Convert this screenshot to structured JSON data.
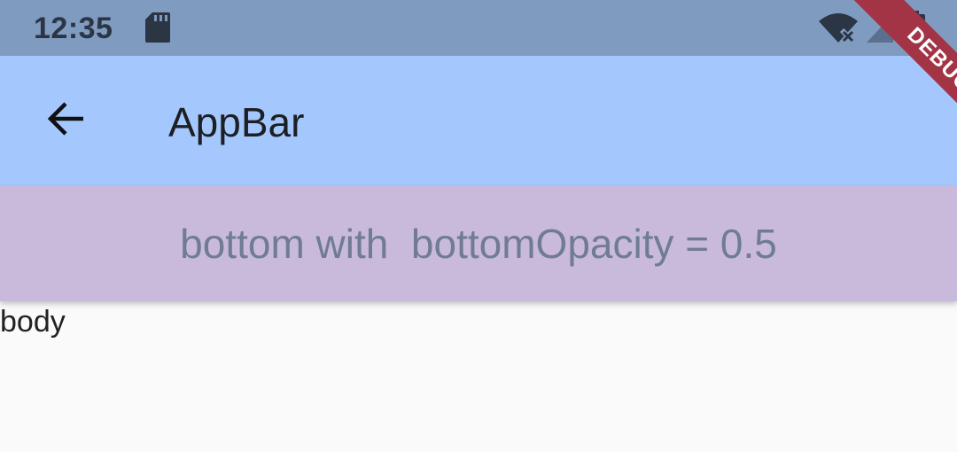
{
  "status_bar": {
    "time": "12:35",
    "icons": [
      "sd-card-icon",
      "wifi-off-icon",
      "signal-icon",
      "battery-charging-icon"
    ]
  },
  "app_bar": {
    "back_icon": "arrow-back-icon",
    "title": "AppBar",
    "bottom_text": "bottom with  bottomOpacity = 0.5"
  },
  "body": {
    "text": "body"
  },
  "debug_banner": {
    "label": "DEBUG"
  },
  "colors": {
    "status_bar": "#7f9bc0",
    "app_bar": "#a4c8fe",
    "bottom": "#c9badb",
    "bottom_text": "#6f7c92",
    "background": "#fafafa",
    "debug_ribbon": "#a33446"
  }
}
